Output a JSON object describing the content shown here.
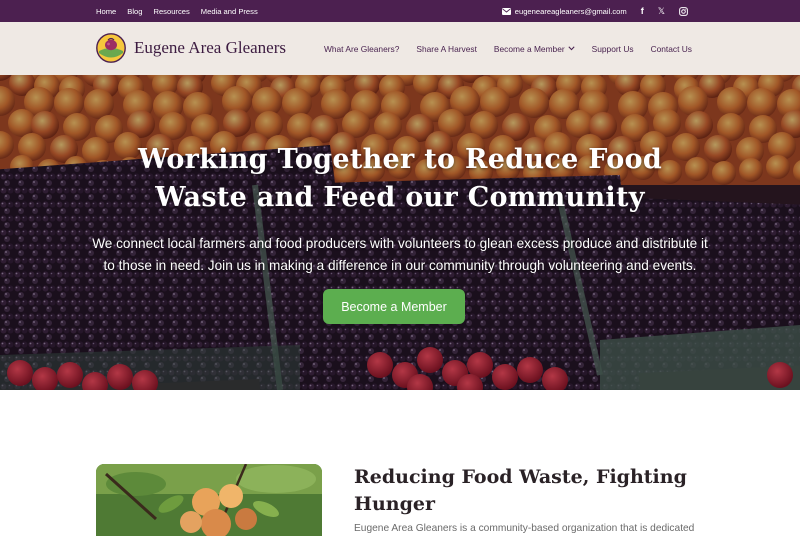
{
  "topbar": {
    "links": [
      "Home",
      "Blog",
      "Resources",
      "Media and Press"
    ],
    "email": "eugeneareagleaners@gmail.com",
    "social": [
      "facebook-icon",
      "x-icon",
      "instagram-icon"
    ]
  },
  "header": {
    "brand": "Eugene Area Gleaners",
    "nav": [
      "What Are Gleaners?",
      "Share A Harvest",
      "Become a Member",
      "Support Us",
      "Contact Us"
    ]
  },
  "hero": {
    "title_line1": "Working Together to Reduce Food",
    "title_line2": "Waste and Feed our Community",
    "subtitle_line1": "We connect local farmers and food producers with volunteers to glean excess produce and distribute it",
    "subtitle_line2": "to those in need. Join us in making a difference in our community through volunteering and events.",
    "button": "Become a Member"
  },
  "section": {
    "title_line1": "Reducing Food Waste, Fighting",
    "title_line2": "Hunger",
    "text": "Eugene Area Gleaners is a community-based organization that is dedicated"
  },
  "colors": {
    "topbar": "#4c2050",
    "header_bg": "#efe9e4",
    "brand_text": "#3c1b40",
    "button_green": "#5cae4f"
  }
}
